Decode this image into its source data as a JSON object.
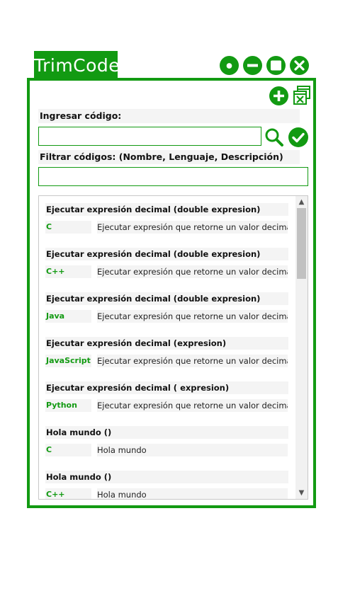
{
  "app": {
    "title": "TrimCode"
  },
  "window_controls": [
    {
      "name": "settings-icon"
    },
    {
      "name": "minimize-icon"
    },
    {
      "name": "maximize-icon"
    },
    {
      "name": "close-icon"
    }
  ],
  "toolbar": {
    "add_icon": "plus-circle-icon",
    "close_all_icon": "close-windows-icon"
  },
  "code_entry": {
    "label": "Ingresar código:",
    "value": "",
    "placeholder": ""
  },
  "filter": {
    "label": "Filtrar códigos: (Nombre, Lenguaje, Descripción)",
    "value": "",
    "placeholder": ""
  },
  "snippets": [
    {
      "title": "Ejecutar expresión decimal (double expresion)",
      "language": "C",
      "description": "Ejecutar expresión que retorne un valor decimal"
    },
    {
      "title": "Ejecutar expresión decimal (double expresion)",
      "language": "C++",
      "description": "Ejecutar expresión que retorne un valor decimal"
    },
    {
      "title": "Ejecutar expresión decimal (double expresion)",
      "language": "Java",
      "description": "Ejecutar expresión que retorne un valor decimal"
    },
    {
      "title": "Ejecutar expresión decimal (expresion)",
      "language": "JavaScript",
      "description": "Ejecutar expresión que retorne un valor decimal"
    },
    {
      "title": "Ejecutar expresión decimal ( expresion)",
      "language": "Python",
      "description": "Ejecutar expresión que retorne un valor decimal"
    },
    {
      "title": "Hola mundo ()",
      "language": "C",
      "description": "Hola mundo"
    },
    {
      "title": "Hola mundo ()",
      "language": "C++",
      "description": "Hola mundo"
    }
  ],
  "colors": {
    "accent": "#129a12",
    "field_bg": "#f4f4f4"
  }
}
